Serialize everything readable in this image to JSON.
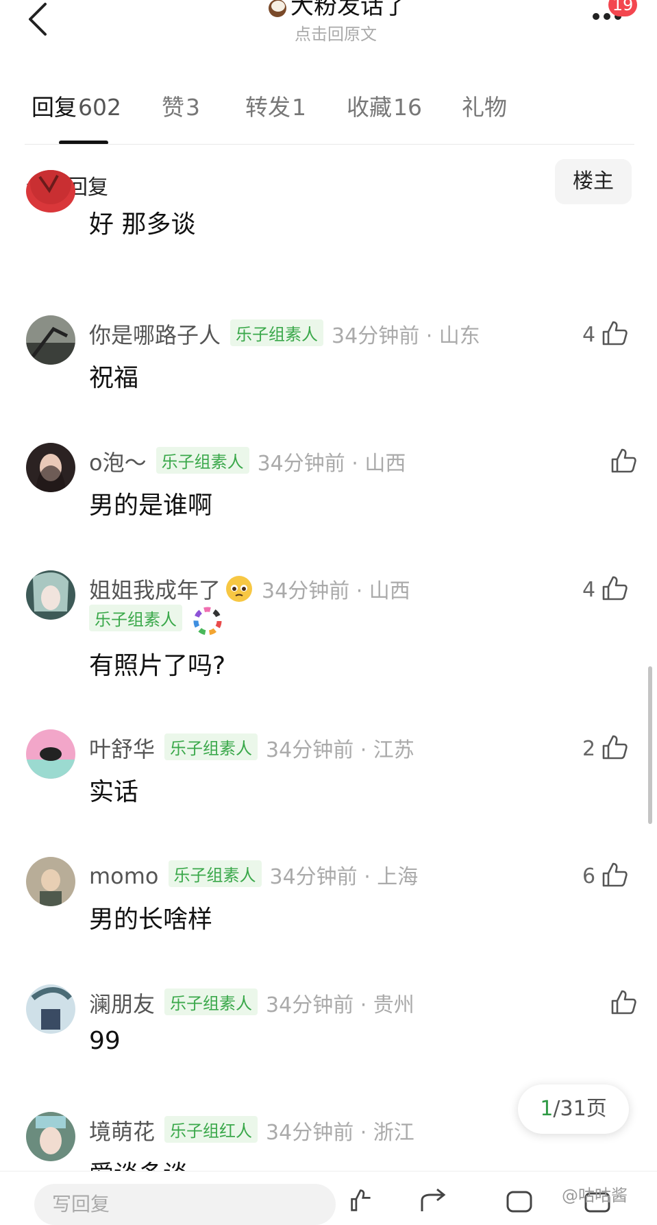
{
  "header": {
    "title": "大粉发话了",
    "subtitle": "点击回原文",
    "notification_count": "19"
  },
  "tabs": [
    {
      "label": "回复",
      "count": "602"
    },
    {
      "label": "赞",
      "count": "3"
    },
    {
      "label": "转发",
      "count": "1"
    },
    {
      "label": "收藏",
      "count": "16"
    },
    {
      "label": "礼物",
      "count": ""
    }
  ],
  "filter": {
    "all_replies": "全部回复",
    "owner_button": "楼主"
  },
  "comments": [
    {
      "text": "好 那多谈"
    },
    {
      "username": "你是哪路子人",
      "tag": "乐子组素人",
      "time": "34分钟前 · 山东",
      "text": "祝福",
      "likes": "4"
    },
    {
      "username": "o泡～",
      "tag": "乐子组素人",
      "time": "34分钟前 · 山西",
      "text": "男的是谁啊",
      "likes": ""
    },
    {
      "username": "姐姐我成年了",
      "tag": "乐子组素人",
      "time": "34分钟前 · 山西",
      "text": "有照片了吗?",
      "likes": "4"
    },
    {
      "username": "叶舒华",
      "tag": "乐子组素人",
      "time": "34分钟前 · 江苏",
      "text": "实话",
      "likes": "2"
    },
    {
      "username": "momo",
      "tag": "乐子组素人",
      "time": "34分钟前 · 上海",
      "text": "男的长啥样",
      "likes": "6"
    },
    {
      "username": "澜朋友",
      "tag": "乐子组素人",
      "time": "34分钟前 · 贵州",
      "text": "99",
      "likes": ""
    },
    {
      "username": "境萌花",
      "tag": "乐子组红人",
      "time": "34分钟前 · 浙江",
      "text": "爱谈多谈",
      "likes": ""
    }
  ],
  "pager": {
    "current": "1",
    "total": "/31页"
  },
  "bottom": {
    "reply_placeholder": "写回复",
    "watermark": "@咕咕酱"
  },
  "colors": {
    "tag_text": "#3aa84a",
    "tag_bg": "#ebf7ea",
    "badge": "#f3464f",
    "pager_current": "#2f9a45"
  }
}
